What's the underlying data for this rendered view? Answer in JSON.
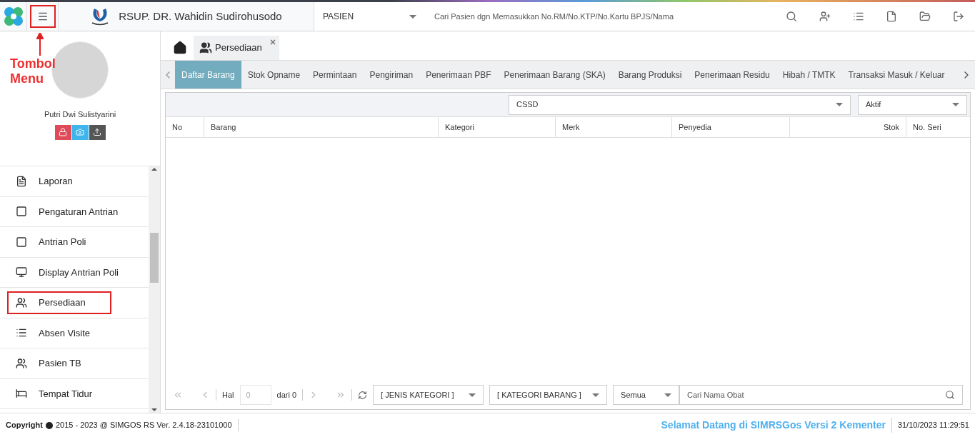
{
  "header": {
    "hospital": "RSUP. DR. Wahidin Sudirohusodo",
    "search_type": "PASIEN",
    "search": {
      "placeholder": "Cari Pasien dgn Memasukkan No.RM/No.KTP/No.Kartu BPJS/Nama"
    }
  },
  "annotation": {
    "text": "Tombol Menu"
  },
  "profile": {
    "name": "Putri Dwi Sulistyarini"
  },
  "sidebar": {
    "items": [
      {
        "label": "Laporan",
        "highlighted": false
      },
      {
        "label": "Pengaturan Antrian",
        "highlighted": false
      },
      {
        "label": "Antrian Poli",
        "highlighted": false
      },
      {
        "label": "Display Antrian Poli",
        "highlighted": false
      },
      {
        "label": "Persediaan",
        "highlighted": true
      },
      {
        "label": "Absen Visite",
        "highlighted": false
      },
      {
        "label": "Pasien TB",
        "highlighted": false
      },
      {
        "label": "Tempat Tidur",
        "highlighted": false
      }
    ]
  },
  "page_tabs": [
    {
      "label": "Persediaan",
      "selected": true
    }
  ],
  "sub_tabs": [
    {
      "label": "Daftar Barang",
      "selected": true
    },
    {
      "label": "Stok Opname",
      "selected": false
    },
    {
      "label": "Permintaan",
      "selected": false
    },
    {
      "label": "Pengiriman",
      "selected": false
    },
    {
      "label": "Penerimaan PBF",
      "selected": false
    },
    {
      "label": "Penerimaan Barang (SKA)",
      "selected": false
    },
    {
      "label": "Barang Produksi",
      "selected": false
    },
    {
      "label": "Penerimaan Residu",
      "selected": false
    },
    {
      "label": "Hibah / TMTK",
      "selected": false
    },
    {
      "label": "Transaksi Masuk / Keluar",
      "selected": false
    }
  ],
  "filters": {
    "unit": "CSSD",
    "status": "Aktif"
  },
  "table": {
    "columns": [
      "No",
      "Barang",
      "Kategori",
      "Merk",
      "Penyedia",
      "Stok",
      "No. Seri"
    ]
  },
  "pagination": {
    "page_label": "Hal",
    "page": "0",
    "of": "dari 0",
    "jenis": "[ JENIS KATEGORI ]",
    "kategori": "[ KATEGORI BARANG ]",
    "scope": "Semua",
    "search": {
      "placeholder": "Cari Nama Obat"
    }
  },
  "status_bar": {
    "copyright_label": "Copyright",
    "copyright": "2015 - 2023 @ SIMGOS RS Ver. 2.4.18-23101000",
    "marquee": "Selamat Datang di SIMRSGos Versi 2 Kementer",
    "datetime": "31/10/2023 11:29:51"
  }
}
